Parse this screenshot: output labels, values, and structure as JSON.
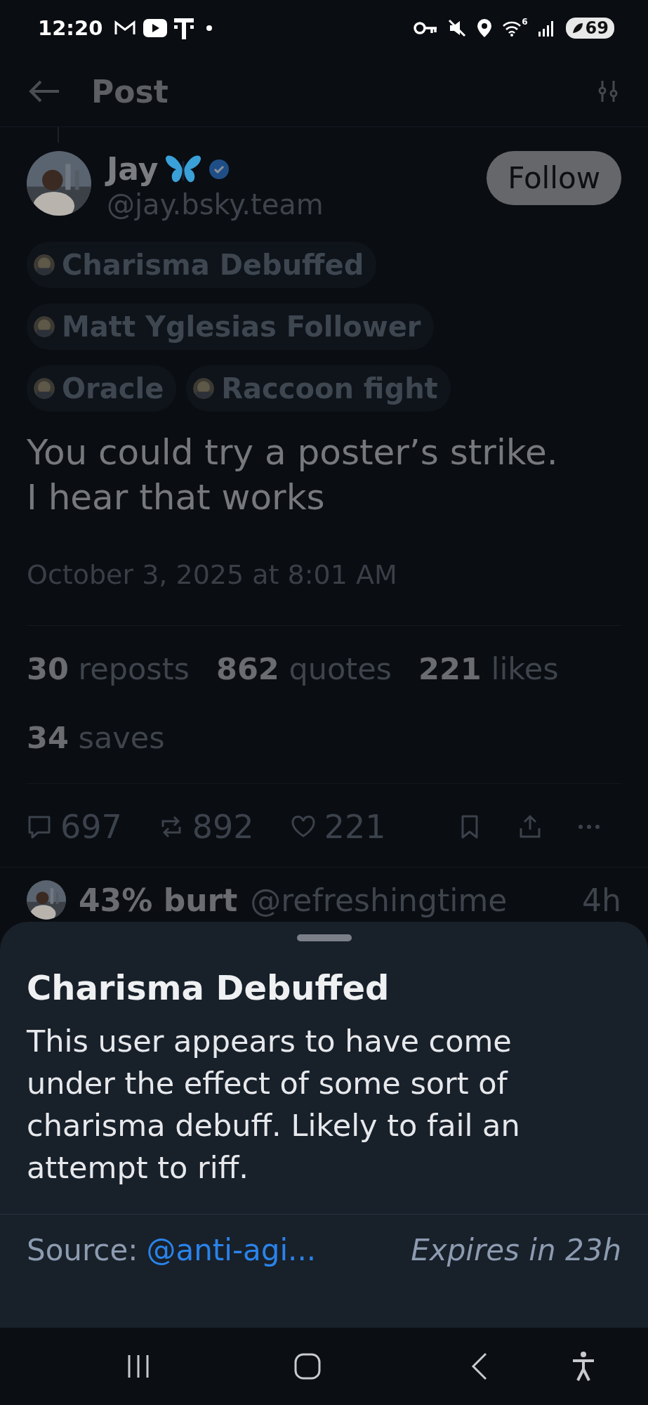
{
  "status_bar": {
    "time": "12:20",
    "wifi_badge": "6",
    "battery": "69"
  },
  "header": {
    "title": "Post"
  },
  "post": {
    "author": {
      "name": "Jay",
      "handle": "@jay.bsky.team",
      "verified": true
    },
    "follow_button": "Follow",
    "labels": [
      {
        "text": "Charisma Debuffed"
      },
      {
        "text": "Matt Yglesias Follower"
      },
      {
        "text": "Oracle"
      },
      {
        "text": "Raccoon fight"
      }
    ],
    "text": "You could try a poster’s strike. I hear that works",
    "timestamp": "October 3, 2025 at 8:01 AM",
    "stats": [
      {
        "count": "30",
        "label": "reposts"
      },
      {
        "count": "862",
        "label": "quotes"
      },
      {
        "count": "221",
        "label": "likes"
      },
      {
        "count": "34",
        "label": "saves"
      }
    ],
    "actions": [
      {
        "kind": "reply",
        "count": "697"
      },
      {
        "kind": "repost",
        "count": "892"
      },
      {
        "kind": "like",
        "count": "221"
      },
      {
        "kind": "bookmark"
      },
      {
        "kind": "share"
      },
      {
        "kind": "more"
      }
    ]
  },
  "reply_preview": {
    "name": "43% burt",
    "handle": "@refreshingtime",
    "time": "4h"
  },
  "sheet": {
    "title": "Charisma Debuffed",
    "body": "This user appears to have come under the effect of some sort of charisma debuff. Likely to fail an attempt to riff.",
    "source_label": "Source:",
    "source_link": "@anti-agi...",
    "expires": "Expires in 23h"
  }
}
